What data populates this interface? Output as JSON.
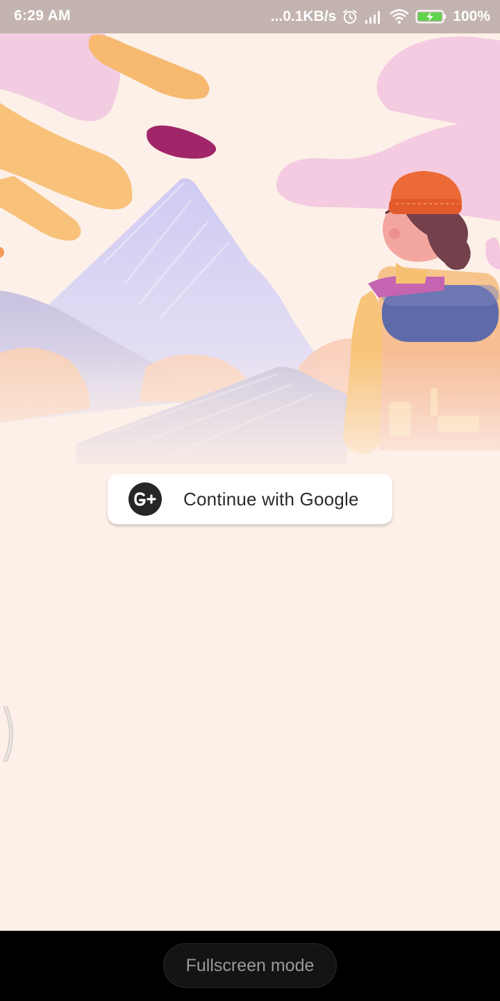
{
  "status_bar": {
    "time": "6:29 AM",
    "network_speed": "...0.1KB/s",
    "battery_percent": "100%",
    "icons": [
      "alarm-icon",
      "signal-icon",
      "wifi-icon",
      "battery-charging-icon"
    ]
  },
  "hero": {
    "description_icon": "traveler-illustration"
  },
  "login": {
    "google_button_label": "Continue with Google",
    "google_icon": "google-plus-icon"
  },
  "nav_bar": {
    "fullscreen_label": "Fullscreen mode"
  },
  "colors": {
    "background": "#fdf0e8",
    "status_bar": "#c3b4af",
    "button_text": "#2b2b2b",
    "nav_bar": "#000000"
  }
}
